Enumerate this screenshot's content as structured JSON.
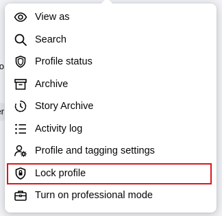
{
  "menu": {
    "items": [
      {
        "label": "View as",
        "icon": "eye-icon"
      },
      {
        "label": "Search",
        "icon": "search-icon"
      },
      {
        "label": "Profile status",
        "icon": "shield-icon"
      },
      {
        "label": "Archive",
        "icon": "archive-box-icon"
      },
      {
        "label": "Story Archive",
        "icon": "story-archive-clock-icon"
      },
      {
        "label": "Activity log",
        "icon": "list-icon"
      },
      {
        "label": "Profile and tagging settings",
        "icon": "profile-settings-gear-icon"
      },
      {
        "label": "Lock profile",
        "icon": "lock-shield-icon",
        "highlighted": true
      },
      {
        "label": "Turn on professional mode",
        "icon": "briefcase-icon"
      }
    ]
  },
  "background": {
    "partial_text_1": "o",
    "partial_text_2": "er"
  },
  "colors": {
    "highlight_border": "#d9161d",
    "text": "#050505",
    "icon": "#050505"
  }
}
